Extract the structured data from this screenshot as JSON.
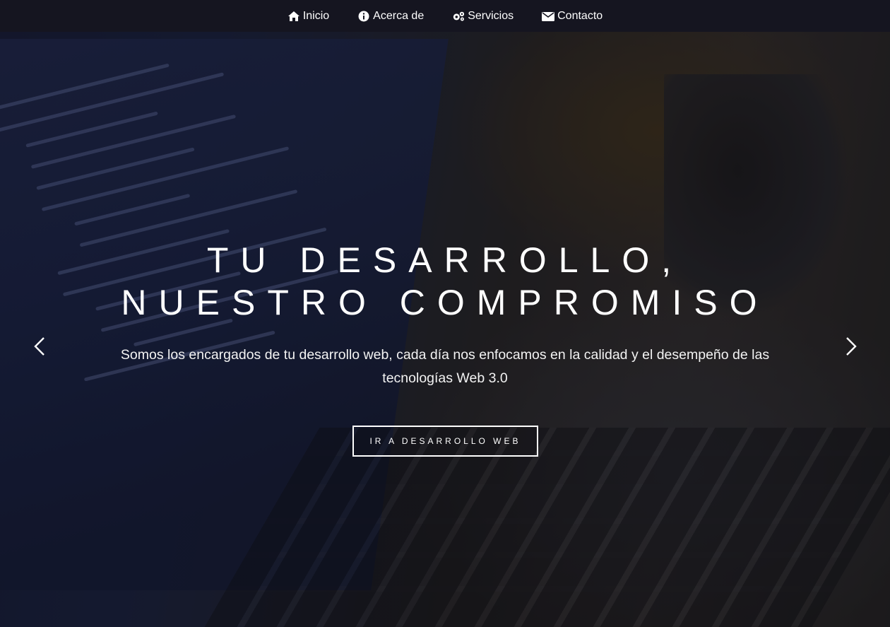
{
  "nav": {
    "items": [
      {
        "label": "Inicio",
        "icon": "home-icon"
      },
      {
        "label": "Acerca de",
        "icon": "info-circle-icon"
      },
      {
        "label": "Servicios",
        "icon": "cogs-icon"
      },
      {
        "label": "Contacto",
        "icon": "envelope-icon"
      }
    ]
  },
  "hero": {
    "headline_line1": "TU DESARROLLO,",
    "headline_line2": "NUESTRO COMPROMISO",
    "subtitle": "Somos los encargados de tu desarrollo web, cada día nos enfocamos en la calidad y el desempeño de las tecnologías Web 3.0",
    "cta_label": "IR A DESARROLLO WEB",
    "prev_icon": "chevron-left-icon",
    "next_icon": "chevron-right-icon"
  },
  "colors": {
    "nav_background": "#151520",
    "text": "#ffffff"
  }
}
